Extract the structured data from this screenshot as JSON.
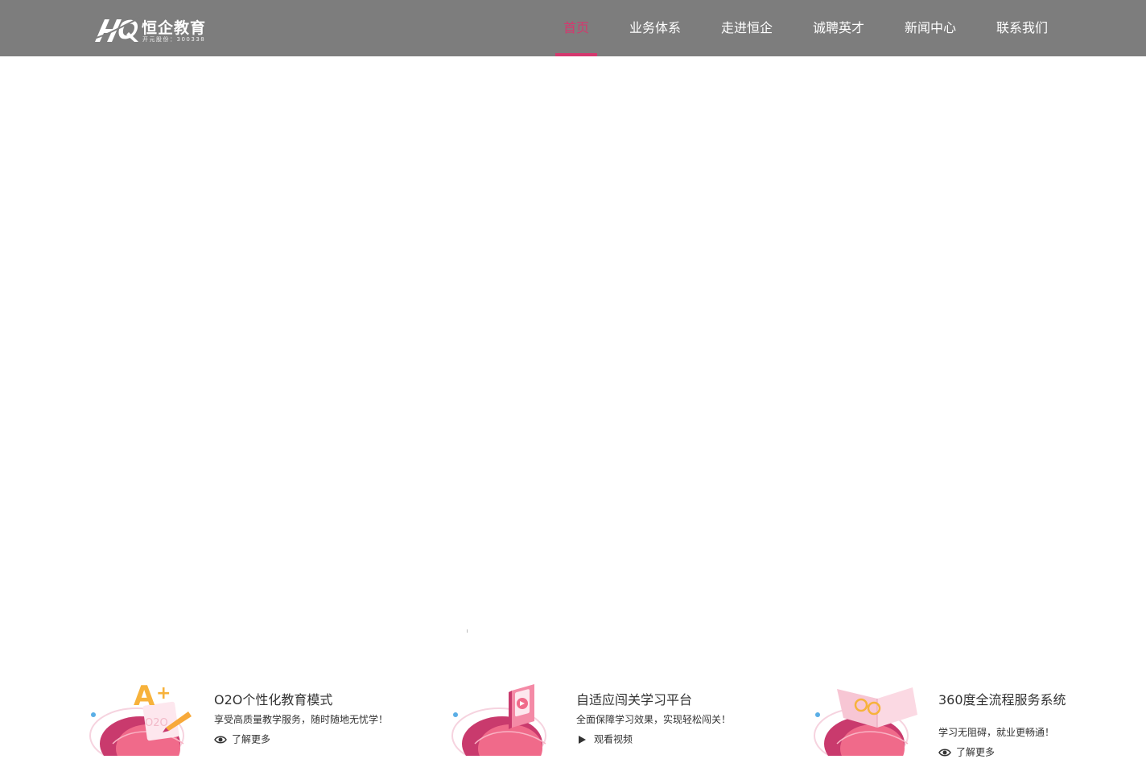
{
  "header": {
    "logo": {
      "brand_name": "恒企教育",
      "sub_text": "开元股份：300338",
      "mark_letters": "HQ"
    },
    "nav": [
      {
        "label": "首页",
        "active": true
      },
      {
        "label": "业务体系",
        "active": false
      },
      {
        "label": "走进恒企",
        "active": false
      },
      {
        "label": "诚聘英才",
        "active": false
      },
      {
        "label": "新闻中心",
        "active": false
      },
      {
        "label": "联系我们",
        "active": false
      }
    ]
  },
  "features": [
    {
      "title": "O2O个性化教育模式",
      "desc": "享受高质量教学服务，随时随地无忧学！",
      "link": "了解更多",
      "link_icon": "eye-icon"
    },
    {
      "title": "自适应闯关学习平台",
      "desc": "全面保障学习效果，实现轻松闯关！",
      "link": "观看视频",
      "link_icon": "play-icon"
    },
    {
      "title": "360度全流程服务系统",
      "desc": "学习无阻碍，就业更畅通！",
      "link": "了解更多",
      "link_icon": "eye-icon"
    }
  ],
  "colors": {
    "header_bg": "#7d7d7d",
    "accent": "#d4386e",
    "text": "#333333"
  }
}
